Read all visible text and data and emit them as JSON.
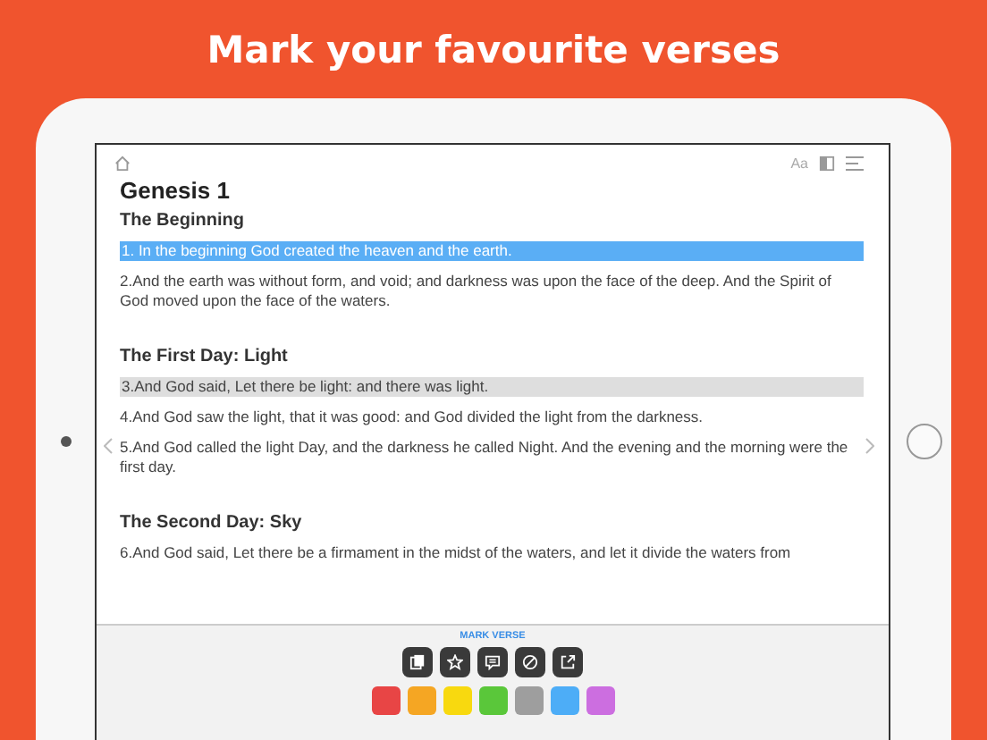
{
  "headline": "Mark your favourite verses",
  "toolbar": {
    "font_button": "Aa"
  },
  "chapter": "Genesis 1",
  "sections": [
    {
      "heading": "The Beginning",
      "verses": [
        {
          "text": "1. In the beginning God created the heaven and the earth.",
          "color": "#5aaef5"
        },
        {
          "text": "2.And the earth was without form, and void; and darkness was upon the face of the deep. And the Spirit of God moved upon the face of the waters."
        }
      ]
    },
    {
      "heading": "The First Day: Light",
      "verses": [
        {
          "text": "3.And God said, Let there be light: and there was light.",
          "color": "#dedede"
        },
        {
          "text": "4.And God saw the light, that it was good: and God divided the light from the darkness."
        },
        {
          "text": "5.And God called the light Day, and the darkness he called Night. And the evening and the morning were the first day."
        }
      ]
    },
    {
      "heading": "The Second Day: Sky",
      "verses": [
        {
          "text": "6.And God said, Let there be a firmament in the midst of the waters, and let it divide the waters from"
        }
      ]
    }
  ],
  "mark_panel": {
    "title": "MARK VERSE",
    "actions": [
      {
        "kind": "copy"
      },
      {
        "kind": "star"
      },
      {
        "kind": "comment"
      },
      {
        "kind": "block"
      },
      {
        "kind": "share"
      }
    ],
    "swatches": [
      {
        "color": "#e84545"
      },
      {
        "color": "#f5a623"
      },
      {
        "color": "#f8d90f"
      },
      {
        "color": "#5ac73a"
      },
      {
        "color": "#9e9e9e"
      },
      {
        "color": "#4dadf7"
      },
      {
        "color": "#cc6ee0"
      }
    ]
  }
}
